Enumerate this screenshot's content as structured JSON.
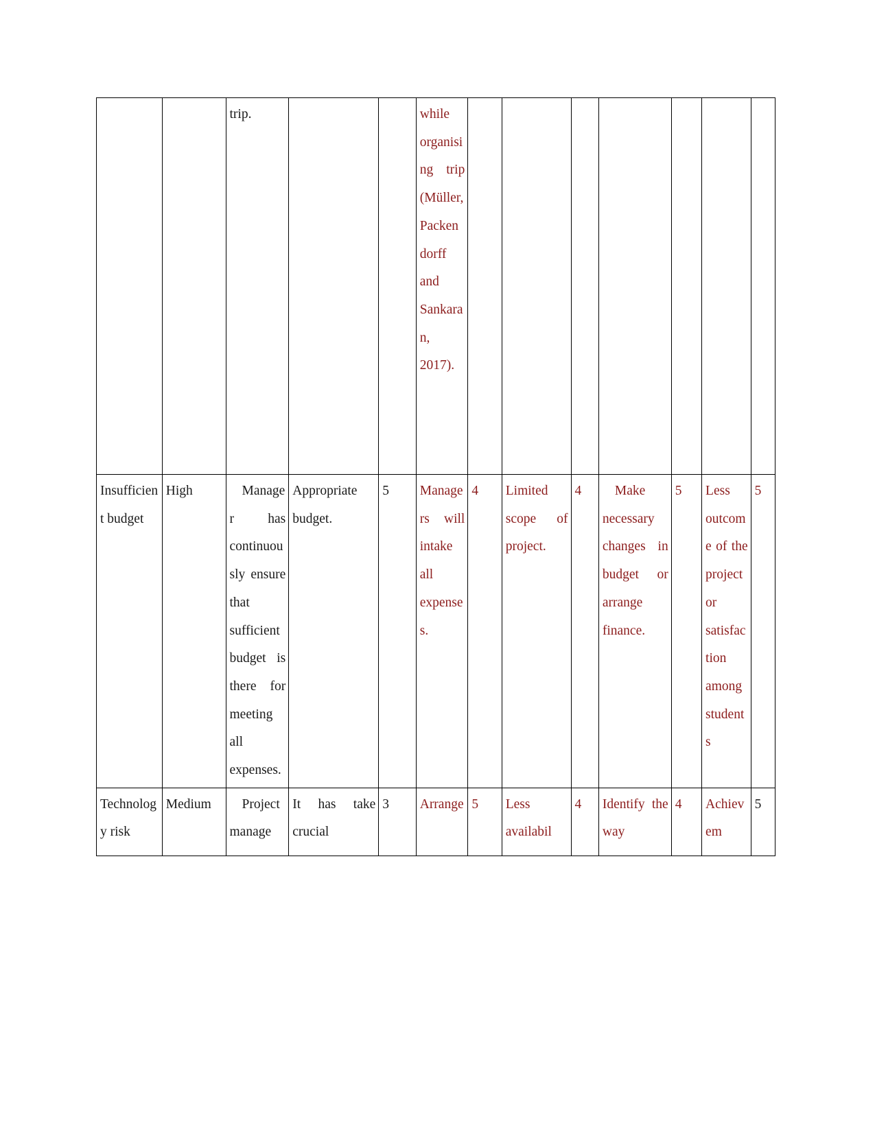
{
  "document": {
    "type": "risk-register-table",
    "page_background": "#ffffff",
    "text_color_primary": "#1a1a1a",
    "text_color_secondary": "#8c1d1d"
  },
  "table": {
    "column_count": 13,
    "rows": [
      {
        "name": "row-continued-trip",
        "cells": [
          {
            "text": "",
            "color": "black",
            "align": "left"
          },
          {
            "text": "",
            "color": "black",
            "align": "left"
          },
          {
            "text": "trip.",
            "color": "black",
            "align": "left"
          },
          {
            "text": "",
            "color": "black",
            "align": "left"
          },
          {
            "text": "",
            "color": "black",
            "align": "left"
          },
          {
            "text": "while organising trip (Müller, Packendorff and Sankaran, 2017).",
            "color": "red",
            "align": "justify"
          },
          {
            "text": "",
            "color": "red",
            "align": "left"
          },
          {
            "text": "",
            "color": "red",
            "align": "left"
          },
          {
            "text": "",
            "color": "red",
            "align": "left"
          },
          {
            "text": "",
            "color": "red",
            "align": "left"
          },
          {
            "text": "",
            "color": "red",
            "align": "left"
          },
          {
            "text": "",
            "color": "red",
            "align": "left"
          },
          {
            "text": "",
            "color": "red",
            "align": "left"
          }
        ]
      },
      {
        "name": "row-insufficient-budget",
        "cells": [
          {
            "text": "Insufficient budget",
            "color": "black",
            "align": "left"
          },
          {
            "text": "High",
            "color": "black",
            "align": "left"
          },
          {
            "text": "Manager has continuously ensure that sufficient budget is there for meeting all expenses.",
            "color": "black",
            "align": "justify",
            "indent": true
          },
          {
            "text": "Appropriate budget.",
            "color": "black",
            "align": "justify"
          },
          {
            "text": "5",
            "color": "black",
            "align": "left"
          },
          {
            "text": "Managers will intake all expenses.",
            "color": "red",
            "align": "justify"
          },
          {
            "text": "4",
            "color": "red",
            "align": "left"
          },
          {
            "text": "Limited scope of project.",
            "color": "red",
            "align": "justify"
          },
          {
            "text": "4",
            "color": "red",
            "align": "left"
          },
          {
            "text": "Make necessary changes in budget or arrange finance.",
            "color": "red",
            "align": "justify",
            "indent": true
          },
          {
            "text": "5",
            "color": "red",
            "align": "left"
          },
          {
            "text": "Less outcome of the project or satisfaction among students",
            "color": "red",
            "align": "justify"
          },
          {
            "text": "5",
            "color": "red",
            "align": "left"
          }
        ]
      },
      {
        "name": "row-technology-risk",
        "cells": [
          {
            "text": "Technology risk",
            "color": "black",
            "align": "left"
          },
          {
            "text": "Medium",
            "color": "black",
            "align": "left"
          },
          {
            "text": "Project manage",
            "color": "black",
            "align": "justify",
            "indent": true
          },
          {
            "text": "It has take crucial",
            "color": "black",
            "align": "justify"
          },
          {
            "text": "3",
            "color": "black",
            "align": "left"
          },
          {
            "text": "Arrange",
            "color": "red",
            "align": "left"
          },
          {
            "text": "5",
            "color": "red",
            "align": "left"
          },
          {
            "text": "Less availabil",
            "color": "red",
            "align": "justify"
          },
          {
            "text": "4",
            "color": "red",
            "align": "left"
          },
          {
            "text": "Identify the way",
            "color": "red",
            "align": "justify"
          },
          {
            "text": "4",
            "color": "red",
            "align": "left"
          },
          {
            "text": "Achievem",
            "color": "red",
            "align": "left"
          },
          {
            "text": "5",
            "color": "black",
            "align": "left"
          }
        ]
      }
    ]
  }
}
